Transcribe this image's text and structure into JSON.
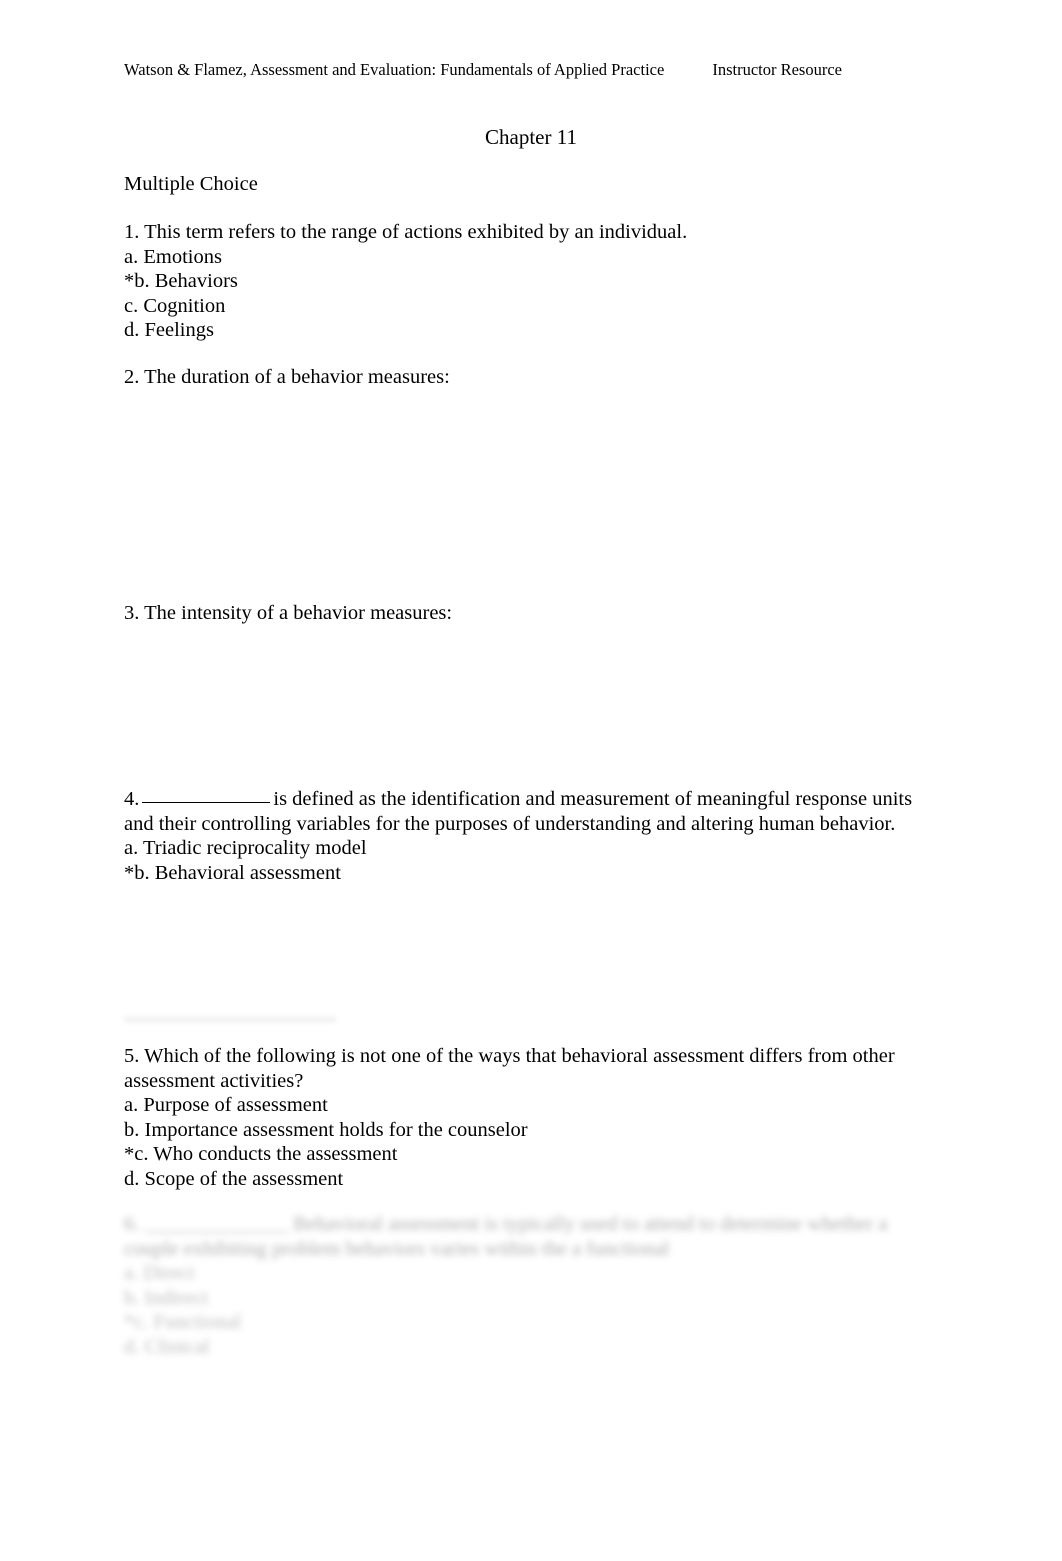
{
  "document": {
    "header_left": "Watson & Flamez, Assessment and Evaluation: Fundamentals of Applied Practice",
    "header_right": "Instructor Resource",
    "chapter_title": "Chapter 11",
    "section_label": "Multiple Choice"
  },
  "questions": [
    {
      "number": "1.",
      "stem": "1. This term refers to the range of actions exhibited by an individual.",
      "options": [
        "a. Emotions",
        "*b. Behaviors",
        "c. Cognition",
        "d. Feelings"
      ]
    },
    {
      "number": "2.",
      "stem": "2. The duration of a behavior measures:",
      "options": []
    },
    {
      "number": "3.",
      "stem": "3. The intensity of a behavior measures:",
      "options": []
    },
    {
      "number": "4.",
      "stem_before_blank": "4.",
      "stem_after_blank": "is defined as the identification and measurement of meaningful response units and their controlling variables for the purposes of understanding and altering human behavior.",
      "options": [
        "a. Triadic reciprocality model",
        "*b. Behavioral assessment"
      ]
    },
    {
      "number": "5.",
      "stem": "5. Which of the following is not one of the ways that behavioral assessment differs from other assessment activities?",
      "options": [
        "a. Purpose of assessment",
        "b. Importance assessment holds for the counselor",
        "*c. Who conducts the assessment",
        "d. Scope of the assessment"
      ]
    },
    {
      "number": "6.",
      "illegible": true,
      "stem_line_1": "6. ______________ Behavioral assessment is typically used to attend to determine whether a",
      "stem_line_2": "couple exhibiting problem behaviors varies within the a functional",
      "options": [
        "a. Direct",
        "b. Indirect",
        "*c. Functional",
        "d. Clinical"
      ]
    }
  ]
}
